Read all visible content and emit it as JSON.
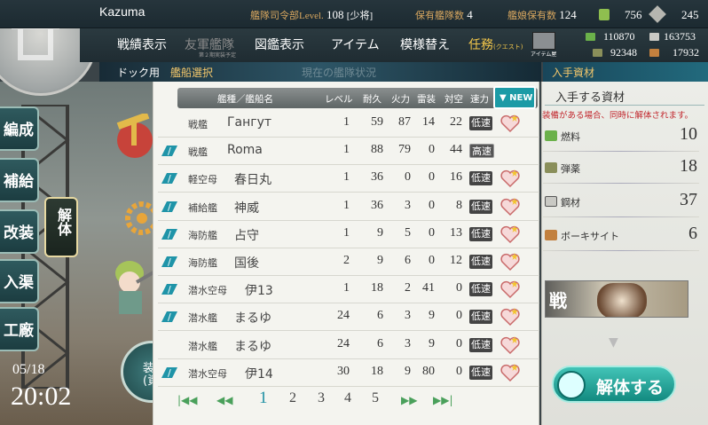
{
  "header": {
    "admiral_name": "Kazuma",
    "hq_level_label": "艦隊司令部Level.",
    "hq_level": "108",
    "rank": "[少将]",
    "fleets_label": "保有艦隊数",
    "fleets": "4",
    "ships_label": "艦娘保有数",
    "ships": "124",
    "buckets": "756",
    "dev_mats": "245"
  },
  "nav": {
    "record": "戦績表示",
    "friendly": "友軍艦隊",
    "friendly_sub": "第２期実装予定",
    "library": "図鑑表示",
    "items": "アイテム",
    "furniture": "模様替え",
    "quest": "任務",
    "quest_sub": "(クエスト)",
    "shop_label": "アイテム屋"
  },
  "resources": {
    "fuel": "110870",
    "steel": "163753",
    "ammo": "92348",
    "bauxite": "17932"
  },
  "breadcrumb": {
    "dock": "ドック用",
    "select": "艦船選択",
    "ghost": "現在の艦隊状況",
    "mat_header": "入手資材"
  },
  "side_menu": {
    "organize": "編成",
    "supply": "補給",
    "remodel": "改装",
    "repair": "入渠",
    "factory": "工廠",
    "dismantle_tab": "解体",
    "round_label": "装備(資"
  },
  "clock": {
    "date": "05/18",
    "time": "20:02"
  },
  "columns": {
    "name": "艦種／艦船名",
    "level": "レベル",
    "hp": "耐久",
    "fire": "火力",
    "torp": "雷装",
    "aa": "対空",
    "speed": "速力",
    "sort": "▼ NEW"
  },
  "ships": [
    {
      "locked": false,
      "type": "戦艦",
      "name": "Гангут",
      "level": "1",
      "hp": "59",
      "fire": "87",
      "torp": "14",
      "aa": "22",
      "speed": "低速",
      "heart": true
    },
    {
      "locked": true,
      "type": "戦艦",
      "name": "Roma",
      "level": "1",
      "hp": "88",
      "fire": "79",
      "torp": "0",
      "aa": "44",
      "speed": "高速",
      "heart": false
    },
    {
      "locked": true,
      "type": "軽空母",
      "name": "春日丸",
      "level": "1",
      "hp": "36",
      "fire": "0",
      "torp": "0",
      "aa": "16",
      "speed": "低速",
      "heart": true
    },
    {
      "locked": true,
      "type": "補給艦",
      "name": "神威",
      "level": "1",
      "hp": "36",
      "fire": "3",
      "torp": "0",
      "aa": "8",
      "speed": "低速",
      "heart": true
    },
    {
      "locked": true,
      "type": "海防艦",
      "name": "占守",
      "level": "1",
      "hp": "9",
      "fire": "5",
      "torp": "0",
      "aa": "13",
      "speed": "低速",
      "heart": true
    },
    {
      "locked": true,
      "type": "海防艦",
      "name": "国後",
      "level": "2",
      "hp": "9",
      "fire": "6",
      "torp": "0",
      "aa": "12",
      "speed": "低速",
      "heart": true
    },
    {
      "locked": true,
      "type": "潜水空母",
      "name": "伊13",
      "level": "1",
      "hp": "18",
      "fire": "2",
      "torp": "41",
      "aa": "0",
      "speed": "低速",
      "heart": true
    },
    {
      "locked": true,
      "type": "潜水艦",
      "name": "まるゆ",
      "level": "24",
      "hp": "6",
      "fire": "3",
      "torp": "9",
      "aa": "0",
      "speed": "低速",
      "heart": true
    },
    {
      "locked": false,
      "type": "潜水艦",
      "name": "まるゆ",
      "level": "24",
      "hp": "6",
      "fire": "3",
      "torp": "9",
      "aa": "0",
      "speed": "低速",
      "heart": true
    },
    {
      "locked": true,
      "type": "潜水空母",
      "name": "伊14",
      "level": "30",
      "hp": "18",
      "fire": "9",
      "torp": "80",
      "aa": "0",
      "speed": "低速",
      "heart": true
    }
  ],
  "pager": {
    "pages": [
      "1",
      "2",
      "3",
      "4",
      "5"
    ],
    "current": "1"
  },
  "materials": {
    "title": "入手する資材",
    "note": "装備がある場合、同時に解体されます。",
    "fuel_label": "燃料",
    "fuel": "10",
    "ammo_label": "弾薬",
    "ammo": "18",
    "steel_label": "鋼材",
    "steel": "37",
    "bauxite_label": "ボーキサイト",
    "bauxite": "6",
    "banner_text": "戦",
    "dismantle_button": "解体する"
  },
  "colors": {
    "accent": "#1c9ba6",
    "lock": "#1f94a8",
    "warning": "#c2272d"
  }
}
